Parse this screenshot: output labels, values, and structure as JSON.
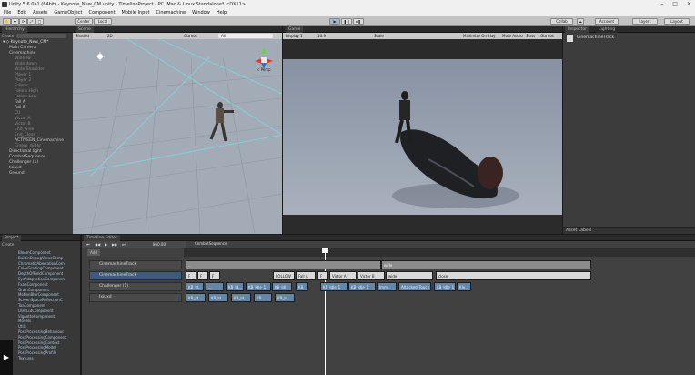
{
  "window": {
    "title": "Unity 5.6.0a1 (64bit) - Keynote_New_CM.unity - TimelineProject - PC, Mac & Linux Standalone* <DX11>"
  },
  "menu": [
    "File",
    "Edit",
    "Assets",
    "GameObject",
    "Component",
    "Mobile Input",
    "Cinemachine",
    "Window",
    "Help"
  ],
  "toolbar": {
    "center": "Center",
    "local": "Local",
    "collab": "Collab",
    "account": "Account",
    "layers": "Layers",
    "layout": "Layout"
  },
  "hierarchy": {
    "tab": "Hierarchy",
    "create": "Create",
    "scene_name": "Keynote_New_CM*",
    "items": [
      {
        "label": "Main Camera",
        "indent": 1,
        "dim": false
      },
      {
        "label": "Cinemachine",
        "indent": 1,
        "dim": false
      },
      {
        "label": "Wide fw",
        "indent": 2,
        "dim": true
      },
      {
        "label": "Wide down",
        "indent": 2,
        "dim": true
      },
      {
        "label": "Wide Shoulder",
        "indent": 2,
        "dim": true
      },
      {
        "label": "Player 1",
        "indent": 2,
        "dim": true
      },
      {
        "label": "Player 2",
        "indent": 2,
        "dim": true
      },
      {
        "label": "Follow",
        "indent": 2,
        "dim": true
      },
      {
        "label": "Follow High",
        "indent": 2,
        "dim": true
      },
      {
        "label": "Follow Low",
        "indent": 2,
        "dim": true
      },
      {
        "label": "Fall A",
        "indent": 2,
        "dim": false
      },
      {
        "label": "Fall B",
        "indent": 2,
        "dim": false
      },
      {
        "label": "CU",
        "indent": 2,
        "dim": true
      },
      {
        "label": "Victor A",
        "indent": 2,
        "dim": true
      },
      {
        "label": "Victor B",
        "indent": 2,
        "dim": true
      },
      {
        "label": "End_wide",
        "indent": 2,
        "dim": true
      },
      {
        "label": "End_Close",
        "indent": 2,
        "dim": true
      },
      {
        "label": "ACTIVEEN_Cinemachine",
        "indent": 2,
        "dim": false
      },
      {
        "label": "Cinem_slider",
        "indent": 2,
        "dim": true
      },
      {
        "label": "Directional light",
        "indent": 1,
        "dim": false
      },
      {
        "label": "CombatSequence",
        "indent": 1,
        "dim": false
      },
      {
        "label": "Challenger (1)",
        "indent": 1,
        "dim": false
      },
      {
        "label": "Ixiuxd",
        "indent": 1,
        "dim": false
      },
      {
        "label": "Ground",
        "indent": 1,
        "dim": false
      }
    ]
  },
  "scene": {
    "tab": "Scene",
    "shading": "Shaded",
    "mode": "2D",
    "gizmos": "Gizmos",
    "search": "All",
    "persp": "< Persp"
  },
  "game": {
    "tab": "Game",
    "display": "Display 1",
    "aspect": "16:9",
    "scale": "Scale",
    "maximize": "Maximize On Play",
    "mute": "Mute Audio",
    "stats": "Stats",
    "gizmos": "Gizmos"
  },
  "inspector": {
    "tab_inspector": "Inspector",
    "tab_lighting": "Lighting",
    "object": "CinemachineTrack",
    "asset_labels": "Asset Labels"
  },
  "project": {
    "tab": "Project",
    "create": "Create",
    "items": [
      "BloomComponent",
      "BuiltinDebugViewsComp",
      "ChromaticAberrationCom",
      "ColorGradingComponent",
      "DepthOfFieldComponent",
      "EyeAdaptationComponen",
      "FxaaComponent",
      "GrainComponent",
      "MotionBlurComponent",
      "ScreenSpaceReflectionC",
      "TaaComponent",
      "UserLutComponent",
      "VignetteComponent",
      "Models",
      "Utils",
      "PostProcessingBehaviour",
      "PostProcessingComponent",
      "PostProcessingContext",
      "PostProcessingModel",
      "PostProcessingProfile",
      "Textures"
    ]
  },
  "timeline": {
    "tab": "Timeline Editor",
    "frame": "860.00",
    "asset": "CombatSequence",
    "add_button": "Add",
    "tracks": [
      {
        "label": "CinemachineTrack",
        "selected": false
      },
      {
        "label": "CinemachineTrack",
        "selected": true
      },
      {
        "label": "Challenger (1)",
        "selected": false
      },
      {
        "label": "Ixiuxd",
        "selected": false
      }
    ],
    "row0_clips": [
      {
        "label": "...",
        "cls": "grey"
      },
      {
        "label": "wide",
        "cls": "grey"
      }
    ],
    "row1_clips": [
      {
        "label": "F",
        "cls": "white"
      },
      {
        "label": "F",
        "cls": "white"
      },
      {
        "label": "F",
        "cls": "white"
      },
      {
        "label": "FOLLOW",
        "cls": "white"
      },
      {
        "label": "Fall A",
        "cls": "white"
      },
      {
        "label": "F",
        "cls": "white"
      },
      {
        "label": "Victor A",
        "cls": "white"
      },
      {
        "label": "Victor B",
        "cls": "white"
      },
      {
        "label": "wide",
        "cls": "white"
      },
      {
        "label": "close",
        "cls": "white"
      }
    ],
    "row2_clips": [
      {
        "label": "KB_Id...",
        "cls": "blue"
      },
      {
        "label": "...",
        "cls": "blue"
      },
      {
        "label": "KB_Id...",
        "cls": "blue"
      },
      {
        "label": "KB_Idle_1",
        "cls": "blue"
      },
      {
        "label": "KB_Idl",
        "cls": "blue"
      },
      {
        "label": "KB",
        "cls": "blue"
      },
      {
        "label": "KB_Idle_1",
        "cls": "blue"
      },
      {
        "label": "KB_Idle_1",
        "cls": "blue"
      },
      {
        "label": "Imm...",
        "cls": "blue"
      },
      {
        "label": "Attacked_Touch_S",
        "cls": "blue"
      },
      {
        "label": "KB_Idle_1",
        "cls": "blue"
      },
      {
        "label": "Kle...",
        "cls": "blue"
      }
    ],
    "row3_clips": [
      {
        "label": "KB_Id...",
        "cls": "blue"
      },
      {
        "label": "KB_Id...",
        "cls": "blue"
      },
      {
        "label": "KB_Id...",
        "cls": "blue"
      },
      {
        "label": "KB...",
        "cls": "blue"
      },
      {
        "label": "KB_Id...",
        "cls": "blue"
      }
    ]
  }
}
